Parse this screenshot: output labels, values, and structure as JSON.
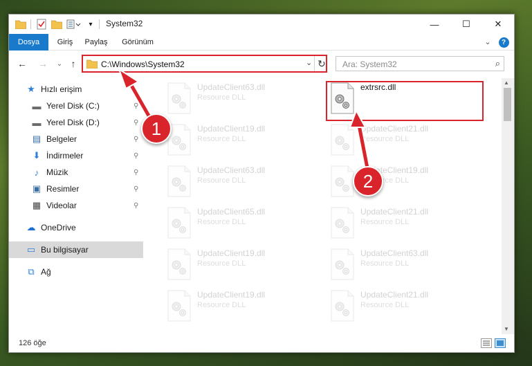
{
  "window": {
    "title": "System32",
    "controls": {
      "minimize": "—",
      "maximize": "☐",
      "close": "✕"
    }
  },
  "ribbon": {
    "tabs": [
      {
        "label": "Dosya",
        "active": true
      },
      {
        "label": "Giriş",
        "active": false
      },
      {
        "label": "Paylaş",
        "active": false
      },
      {
        "label": "Görünüm",
        "active": false
      }
    ],
    "expand": "⌄",
    "help": "?"
  },
  "nav": {
    "back": "←",
    "forward": "→",
    "recent": "⌄",
    "up": "↑",
    "address": "C:\\Windows\\System32",
    "address_dropdown": "⌄",
    "refresh": "↻",
    "search_placeholder": "Ara: System32",
    "search_icon": "⌕"
  },
  "sidebar": {
    "items": [
      {
        "label": "Hızlı erişim",
        "icon": "star-icon",
        "glyph": "★",
        "color": "#2f7fd8",
        "pinned": false
      },
      {
        "label": "Yerel Disk (C:)",
        "icon": "drive-icon",
        "glyph": "▬",
        "color": "#6b6b6b",
        "pinned": true
      },
      {
        "label": "Yerel Disk (D:)",
        "icon": "drive-icon",
        "glyph": "▬",
        "color": "#6b6b6b",
        "pinned": true
      },
      {
        "label": "Belgeler",
        "icon": "documents-icon",
        "glyph": "▤",
        "color": "#3a6ea5",
        "pinned": true
      },
      {
        "label": "İndirmeler",
        "icon": "download-icon",
        "glyph": "⬇",
        "color": "#2f7fd8",
        "pinned": true
      },
      {
        "label": "Müzik",
        "icon": "music-icon",
        "glyph": "♪",
        "color": "#2f7fd8",
        "pinned": true
      },
      {
        "label": "Resimler",
        "icon": "pictures-icon",
        "glyph": "▣",
        "color": "#3a6ea5",
        "pinned": true
      },
      {
        "label": "Videolar",
        "icon": "videos-icon",
        "glyph": "▦",
        "color": "#444444",
        "pinned": true
      },
      {
        "label": "OneDrive",
        "icon": "cloud-icon",
        "glyph": "☁",
        "color": "#1c6fd4",
        "pinned": false
      },
      {
        "label": "Bu bilgisayar",
        "icon": "computer-icon",
        "glyph": "▭",
        "color": "#2f7fd8",
        "pinned": false,
        "selected": true
      },
      {
        "label": "Ağ",
        "icon": "network-icon",
        "glyph": "⧉",
        "color": "#2f7fd8",
        "pinned": false
      }
    ],
    "pin_glyph": "📌"
  },
  "files": [
    {
      "name": "UpdateClient63.dll",
      "desc": "Resource DLL",
      "faded": true
    },
    {
      "name": "extrsrc.dll",
      "desc": "",
      "faded": false
    },
    {
      "name": "UpdateClient19.dll",
      "desc": "Resource DLL",
      "faded": true
    },
    {
      "name": "UpdateClient21.dll",
      "desc": "Resource DLL",
      "faded": true
    },
    {
      "name": "UpdateClient63.dll",
      "desc": "Resource DLL",
      "faded": true
    },
    {
      "name": "UpdateClient19.dll",
      "desc": "Resource DLL",
      "faded": true
    },
    {
      "name": "UpdateClient65.dll",
      "desc": "Resource DLL",
      "faded": true
    },
    {
      "name": "UpdateClient21.dll",
      "desc": "Resource DLL",
      "faded": true
    },
    {
      "name": "UpdateClient19.dll",
      "desc": "Resource DLL",
      "faded": true
    },
    {
      "name": "UpdateClient63.dll",
      "desc": "Resource DLL",
      "faded": true
    },
    {
      "name": "UpdateClient19.dll",
      "desc": "Resource DLL",
      "faded": true
    },
    {
      "name": "UpdateClient21.dll",
      "desc": "Resource DLL",
      "faded": true
    }
  ],
  "status": {
    "count": "126 öğe"
  },
  "annotations": {
    "badge1": "1",
    "badge2": "2",
    "color": "#d9242b"
  }
}
